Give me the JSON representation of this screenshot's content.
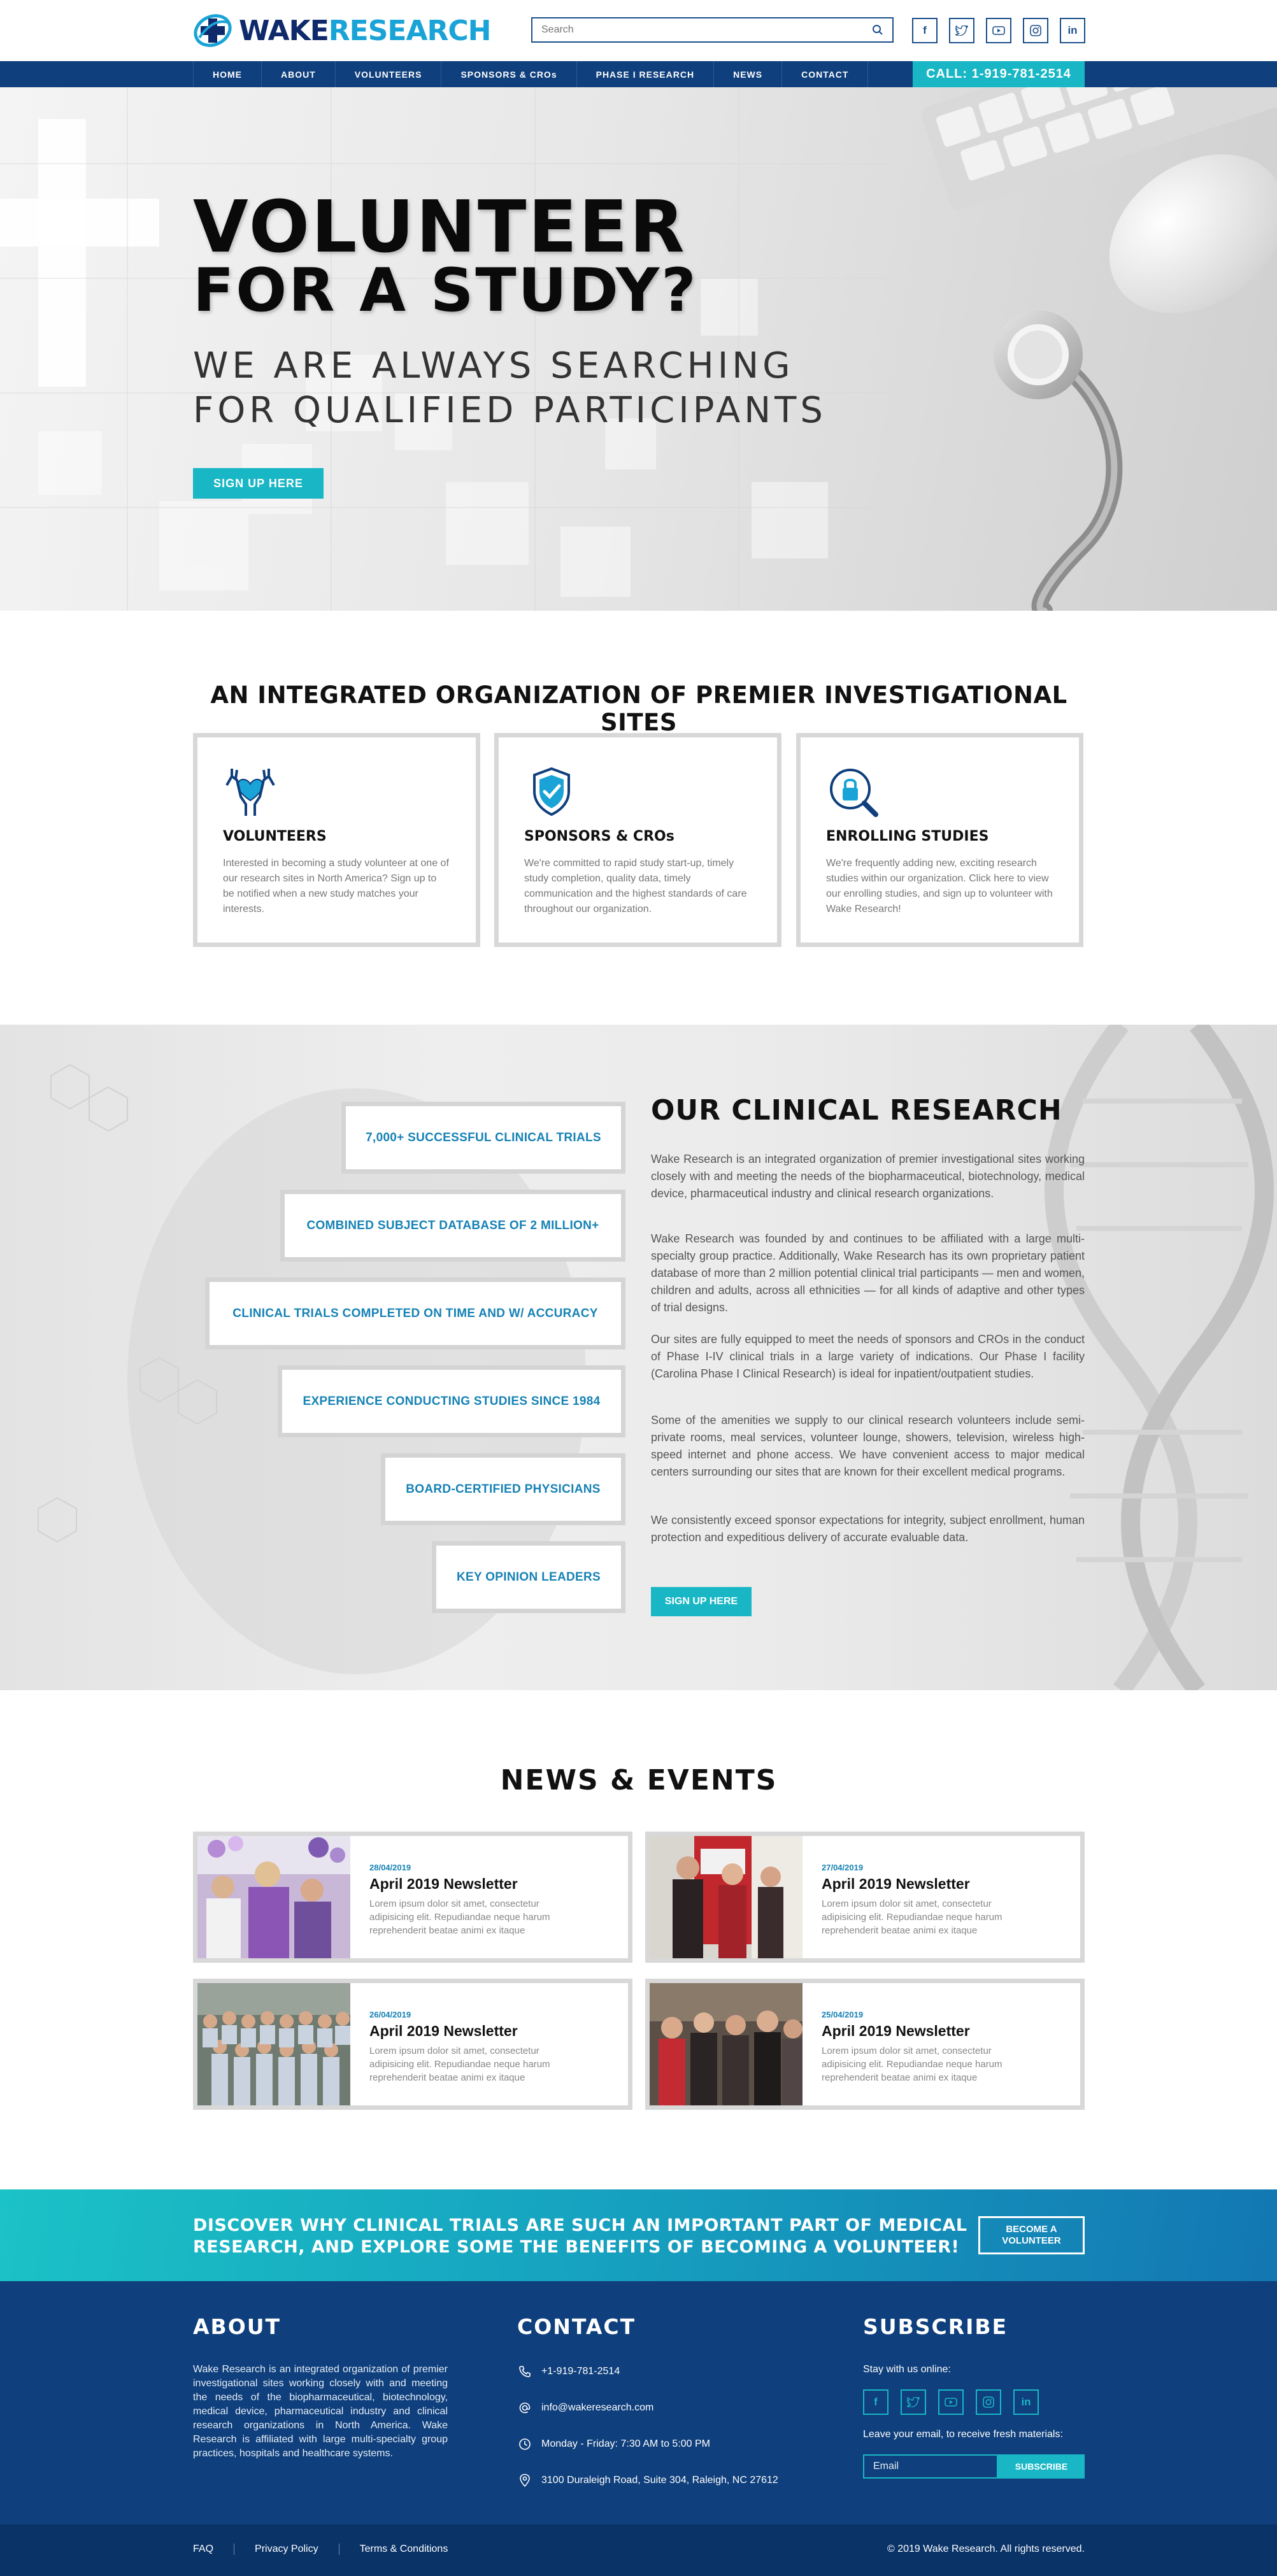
{
  "brand": {
    "logo_part1": "WAKE",
    "logo_part2": "RESEARCH"
  },
  "search": {
    "placeholder": "Search"
  },
  "social_icons": [
    "facebook-icon",
    "twitter-icon",
    "youtube-icon",
    "instagram-icon",
    "linkedin-icon"
  ],
  "nav": {
    "items": [
      "HOME",
      "ABOUT",
      "VOLUNTEERS",
      "SPONSORS & CROs",
      "PHASE I RESEARCH",
      "NEWS",
      "CONTACT"
    ],
    "call": "CALL: 1-919-781-2514"
  },
  "hero": {
    "title_line1": "VOLUNTEER",
    "title_line2": "FOR A STUDY?",
    "subtitle_line1": "WE ARE ALWAYS SEARCHING",
    "subtitle_line2": "FOR QUALIFIED PARTICIPANTS",
    "button": "SIGN UP HERE"
  },
  "integrated": {
    "title": "AN INTEGRATED ORGANIZATION OF PREMIER INVESTIGATIONAL SITES",
    "features": [
      {
        "icon": "hands-heart-icon",
        "title": "VOLUNTEERS",
        "text": "Interested in becoming a study volunteer at one of our research sites in North America? Sign up to be notified when a new study matches your interests."
      },
      {
        "icon": "shield-check-icon",
        "title": "SPONSORS & CROs",
        "text": "We're committed to rapid study start-up, timely study completion, quality data, timely communication and the highest standards of care throughout our organization."
      },
      {
        "icon": "lock-search-icon",
        "title": "ENROLLING STUDIES",
        "text": "We're frequently adding new, exciting research studies within our organization. Click here to view our enrolling studies, and sign up to volunteer with Wake Research!"
      }
    ]
  },
  "clinical": {
    "stats": [
      "7,000+ SUCCESSFUL CLINICAL TRIALS",
      "COMBINED SUBJECT DATABASE OF 2 MILLION+",
      "CLINICAL TRIALS COMPLETED ON TIME AND W/ ACCURACY",
      "EXPERIENCE CONDUCTING STUDIES SINCE 1984",
      "BOARD-CERTIFIED PHYSICIANS",
      "KEY OPINION LEADERS"
    ],
    "title": "OUR CLINICAL RESEARCH",
    "paragraphs": [
      "Wake Research is an integrated organization of premier investigational sites working closely with and meeting the needs of the biopharmaceutical, biotechnology, medical device, pharmaceutical industry and clinical research organizations.",
      "Wake Research was founded by and continues to be affiliated with a large multi-specialty group practice. Additionally, Wake Research has its own proprietary patient database of more than 2 million potential clinical trial participants — men and women, children and adults, across all ethnicities — for all kinds of adaptive and other types of trial designs.",
      "Our sites are fully equipped to meet the needs of sponsors and CROs in the conduct of Phase I-IV clinical trials in a large variety of indications. Our Phase I facility (Carolina Phase I Clinical Research) is ideal for inpatient/outpatient studies.",
      "Some of the amenities we supply to our clinical research volunteers include semi-private rooms, meal services, volunteer lounge, showers, television, wireless high-speed internet and phone access. We have convenient access to major medical centers surrounding our sites that are known for their excellent medical programs.",
      "We consistently exceed sponsor expectations for integrity, subject enrollment, human protection and expeditious delivery of accurate evaluable data."
    ],
    "button": "SIGN UP HERE"
  },
  "news": {
    "title": "NEWS & EVENTS",
    "items": [
      {
        "date": "28/04/2019",
        "title": "April 2019 Newsletter",
        "text": "Lorem ipsum dolor sit amet, consectetur adipisicing elit. Repudiandae neque harum reprehenderit beatae animi ex itaque"
      },
      {
        "date": "27/04/2019",
        "title": "April 2019 Newsletter",
        "text": "Lorem ipsum dolor sit amet, consectetur adipisicing elit. Repudiandae neque harum reprehenderit beatae animi ex itaque"
      },
      {
        "date": "26/04/2019",
        "title": "April 2019 Newsletter",
        "text": "Lorem ipsum dolor sit amet, consectetur adipisicing elit. Repudiandae neque harum reprehenderit beatae animi ex itaque"
      },
      {
        "date": "25/04/2019",
        "title": "April 2019 Newsletter",
        "text": "Lorem ipsum dolor sit amet, consectetur adipisicing elit. Repudiandae neque harum reprehenderit beatae animi ex itaque"
      }
    ]
  },
  "cta": {
    "text_line1": "DISCOVER WHY CLINICAL TRIALS ARE SUCH AN IMPORTANT PART OF MEDICAL",
    "text_line2": "RESEARCH, AND EXPLORE SOME THE BENEFITS OF BECOMING A VOLUNTEER!",
    "button_line1": "BECOME A",
    "button_line2": "VOLUNTEER"
  },
  "footer": {
    "about_title": "ABOUT",
    "about_text": "Wake Research is an integrated organization of premier investigational sites working closely with and meeting the needs of the biopharmaceutical, biotechnology, medical device, pharmaceutical industry and clinical research organizations in North America. Wake Research is affiliated with large multi-specialty group practices, hospitals and healthcare systems.",
    "contact_title": "CONTACT",
    "phone": "+1-919-781-2514",
    "email": "info@wakeresearch.com",
    "hours": "Monday - Friday: 7:30 AM to 5:00 PM",
    "address": "3100 Duraleigh Road, Suite 304, Raleigh, NC 27612",
    "subscribe_title": "SUBSCRIBE",
    "stay_with_us": "Stay with us online:",
    "leave_email": "Leave your email, to receive fresh materials:",
    "email_placeholder": "Email",
    "subscribe_button": "SUBSCRIBE"
  },
  "bottom": {
    "links": [
      "FAQ",
      "Privacy Policy",
      "Terms & Conditions"
    ],
    "copyright": "© 2019 Wake Research. All rights reserved."
  },
  "colors": {
    "navy": "#0f3f7c",
    "teal": "#19b7c5",
    "blue_text": "#1682b5"
  }
}
